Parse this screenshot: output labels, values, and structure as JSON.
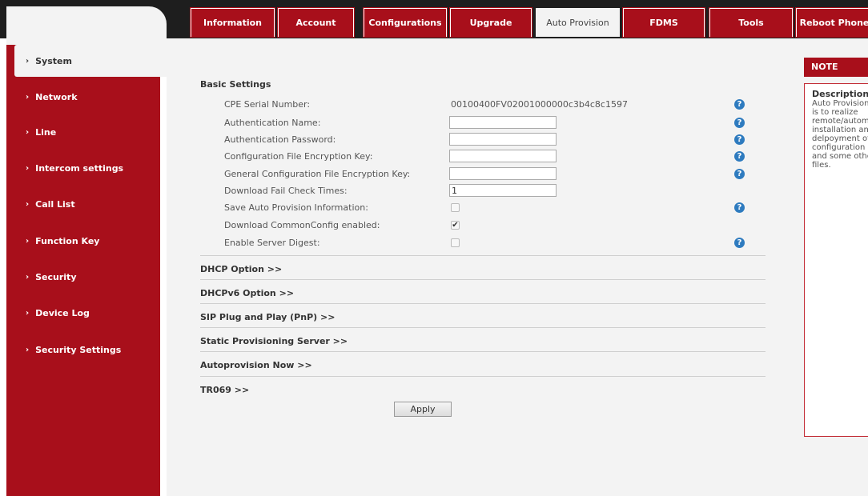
{
  "tabs": [
    {
      "label": "Information",
      "active": false
    },
    {
      "label": "Account",
      "active": false
    },
    {
      "label": "Configurations",
      "active": false
    },
    {
      "label": "Upgrade",
      "active": false
    },
    {
      "label": "Auto Provision",
      "active": true
    },
    {
      "label": "FDMS",
      "active": false
    },
    {
      "label": "Tools",
      "active": false
    },
    {
      "label": "Reboot Phone",
      "active": false
    }
  ],
  "sidebar": {
    "items": [
      {
        "label": "System",
        "active": true
      },
      {
        "label": "Network"
      },
      {
        "label": "Line"
      },
      {
        "label": "Intercom settings"
      },
      {
        "label": "Call List"
      },
      {
        "label": "Function Key"
      },
      {
        "label": "Security"
      },
      {
        "label": "Device Log"
      },
      {
        "label": "Security Settings"
      }
    ]
  },
  "basic": {
    "title": "Basic Settings",
    "cpe_label": "CPE Serial Number:",
    "cpe_value": "00100400FV02001000000c3b4c8c1597",
    "auth_name_label": "Authentication Name:",
    "auth_name_value": "",
    "auth_pass_label": "Authentication Password:",
    "auth_pass_value": "",
    "cfg_key_label": "Configuration File Encryption Key:",
    "cfg_key_value": "",
    "gen_key_label": "General Configuration File Encryption Key:",
    "gen_key_value": "",
    "fail_label": "Download Fail Check Times:",
    "fail_value": "1",
    "save_label": "Save Auto Provision Information:",
    "save_checked": false,
    "common_label": "Download CommonConfig enabled:",
    "common_checked": true,
    "digest_label": "Enable Server Digest:",
    "digest_checked": false
  },
  "sections": [
    "DHCP Option >>",
    "DHCPv6 Option >>",
    "SIP Plug and Play (PnP) >>",
    "Static Provisioning Server >>",
    "Autoprovision Now >>",
    "TR069 >>"
  ],
  "apply_label": "Apply",
  "note": {
    "header": "NOTE",
    "title": "Description:",
    "text": "Auto Provision is to realize remote/automatic installation and delpoyment of configuration and some other files."
  },
  "colors": {
    "brand_red": "#a80f1b",
    "help_blue": "#2e7bbf",
    "panel_bg": "#f3f3f3"
  }
}
